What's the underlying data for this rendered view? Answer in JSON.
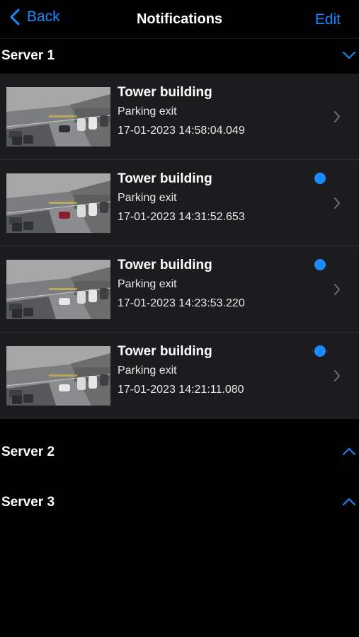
{
  "nav": {
    "back_label": "Back",
    "title": "Notifications",
    "edit_label": "Edit"
  },
  "sections": [
    {
      "label": "Server 1",
      "expanded": true
    },
    {
      "label": "Server 2",
      "expanded": false
    },
    {
      "label": "Server 3",
      "expanded": false
    }
  ],
  "notifications": [
    {
      "title": "Tower building",
      "subtitle": "Parking exit",
      "time": "17-01-2023 14:58:04.049",
      "unread": false
    },
    {
      "title": "Tower building",
      "subtitle": "Parking exit",
      "time": "17-01-2023 14:31:52.653",
      "unread": true
    },
    {
      "title": "Tower building",
      "subtitle": "Parking exit",
      "time": "17-01-2023 14:23:53.220",
      "unread": true
    },
    {
      "title": "Tower building",
      "subtitle": "Parking exit",
      "time": "17-01-2023 14:21:11.080",
      "unread": true
    }
  ],
  "colors": {
    "accent": "#1a8cff",
    "background": "#000000",
    "card": "#1c1c1e"
  },
  "icons": {
    "back": "chevron-left-icon",
    "expand": "chevron-down-icon",
    "collapse": "chevron-up-icon",
    "disclosure": "chevron-right-icon"
  }
}
